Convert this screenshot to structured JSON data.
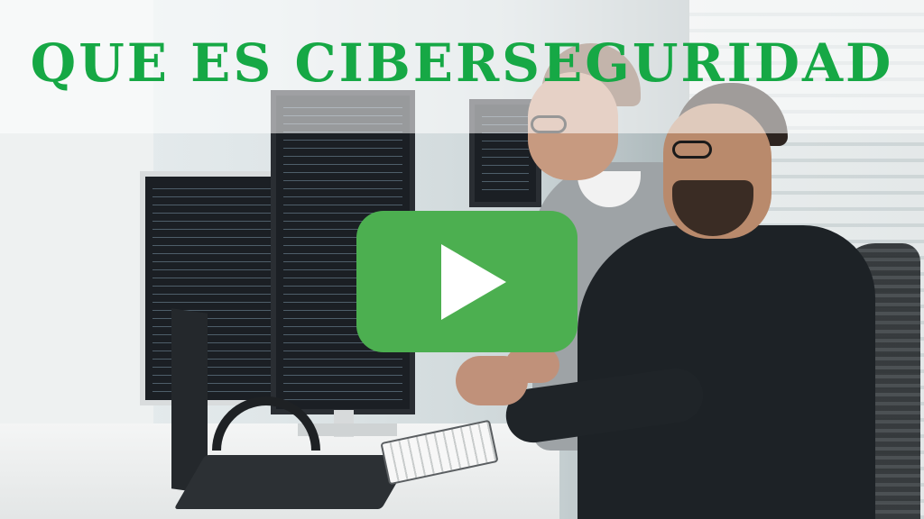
{
  "video": {
    "title": "QUE ES CIBERSEGURIDAD",
    "play_icon": "play-icon"
  },
  "colors": {
    "title": "#16a845",
    "play_button": "#4caf50",
    "play_icon": "#ffffff"
  }
}
